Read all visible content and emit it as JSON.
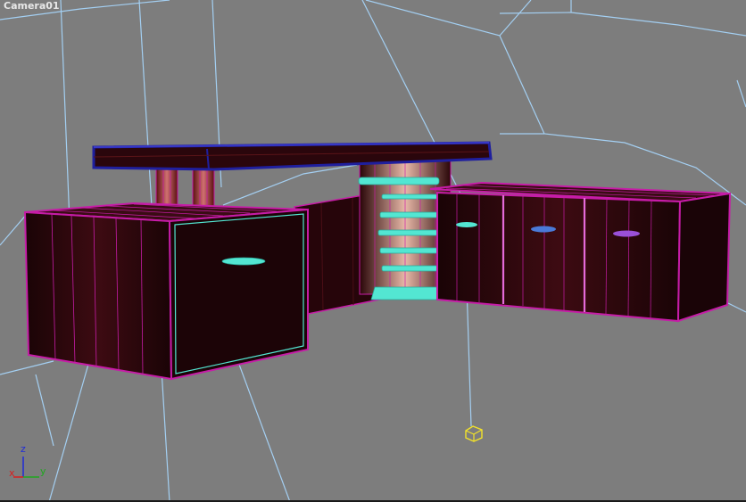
{
  "viewport": {
    "label": "Camera01",
    "background": "#7d7d7d"
  },
  "axis_gizmo": {
    "z_label": "z",
    "x_label": "x",
    "y_label": "y",
    "z_color": "#1e2bd8",
    "x_color": "#d81e1e",
    "y_color": "#1ea81e"
  },
  "colors": {
    "wireframe_selected": "#c61ca7",
    "wire_blue": "#1f1f9e",
    "wire_cyan": "#53e6d2",
    "wood_dark": "#1e0507",
    "wood_mid": "#3a0b10",
    "grid_line": "#a8d8ff",
    "camera_target": "#f2e22a"
  },
  "icons": {
    "camera_target": "camera-target-icon"
  }
}
